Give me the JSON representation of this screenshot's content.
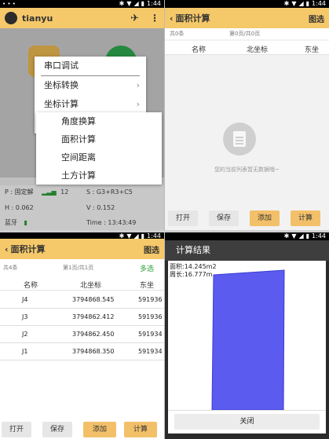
{
  "status_bar": {
    "time": "1:44",
    "left_icon": "dots-icon"
  },
  "home": {
    "app_title": "tianyu",
    "menu_main": [
      "串口调试",
      "坐标转换",
      "坐标计算"
    ],
    "menu_sub": [
      "角度换算",
      "面积计算",
      "空间距离",
      "土方计算"
    ],
    "status": {
      "p_label": "P : 固定解",
      "signal_count": "12",
      "s_label": "S : G3+R3+C5",
      "h_label": "H : 0.062",
      "v_label": "V : 0.152",
      "bt_label": "蓝牙",
      "time_label": "Time : 13:43:49"
    }
  },
  "area_empty": {
    "title": "面积计算",
    "action": "图选",
    "count": "共0条",
    "page": "第0页/共0页",
    "columns": [
      "名称",
      "北坐标",
      "东坐"
    ],
    "empty_message": "您的当前列表暂无数据哦~",
    "buttons": [
      "打开",
      "保存",
      "添加",
      "计算"
    ]
  },
  "area_list": {
    "title": "面积计算",
    "action": "图选",
    "count": "共4条",
    "page": "第1页/共1页",
    "multi_select": "多选",
    "columns": [
      "名称",
      "北坐标",
      "东坐"
    ],
    "rows": [
      {
        "name": "J4",
        "north": "3794868.545",
        "east": "591936"
      },
      {
        "name": "J3",
        "north": "3794862.412",
        "east": "591936"
      },
      {
        "name": "J2",
        "north": "3794862.450",
        "east": "591934"
      },
      {
        "name": "J1",
        "north": "3794868.350",
        "east": "591934"
      }
    ],
    "buttons": [
      "打开",
      "保存",
      "添加",
      "计算"
    ]
  },
  "result": {
    "title": "计算结果",
    "area_text": "面积:14.245m2",
    "perimeter_text": "周长:16.777m",
    "close_label": "关闭",
    "polygon_color": "#5b5bf0"
  },
  "colors": {
    "accent": "#f5c86a",
    "button_gold": "#f3c06a",
    "multi_select": "#2a9d3a"
  }
}
